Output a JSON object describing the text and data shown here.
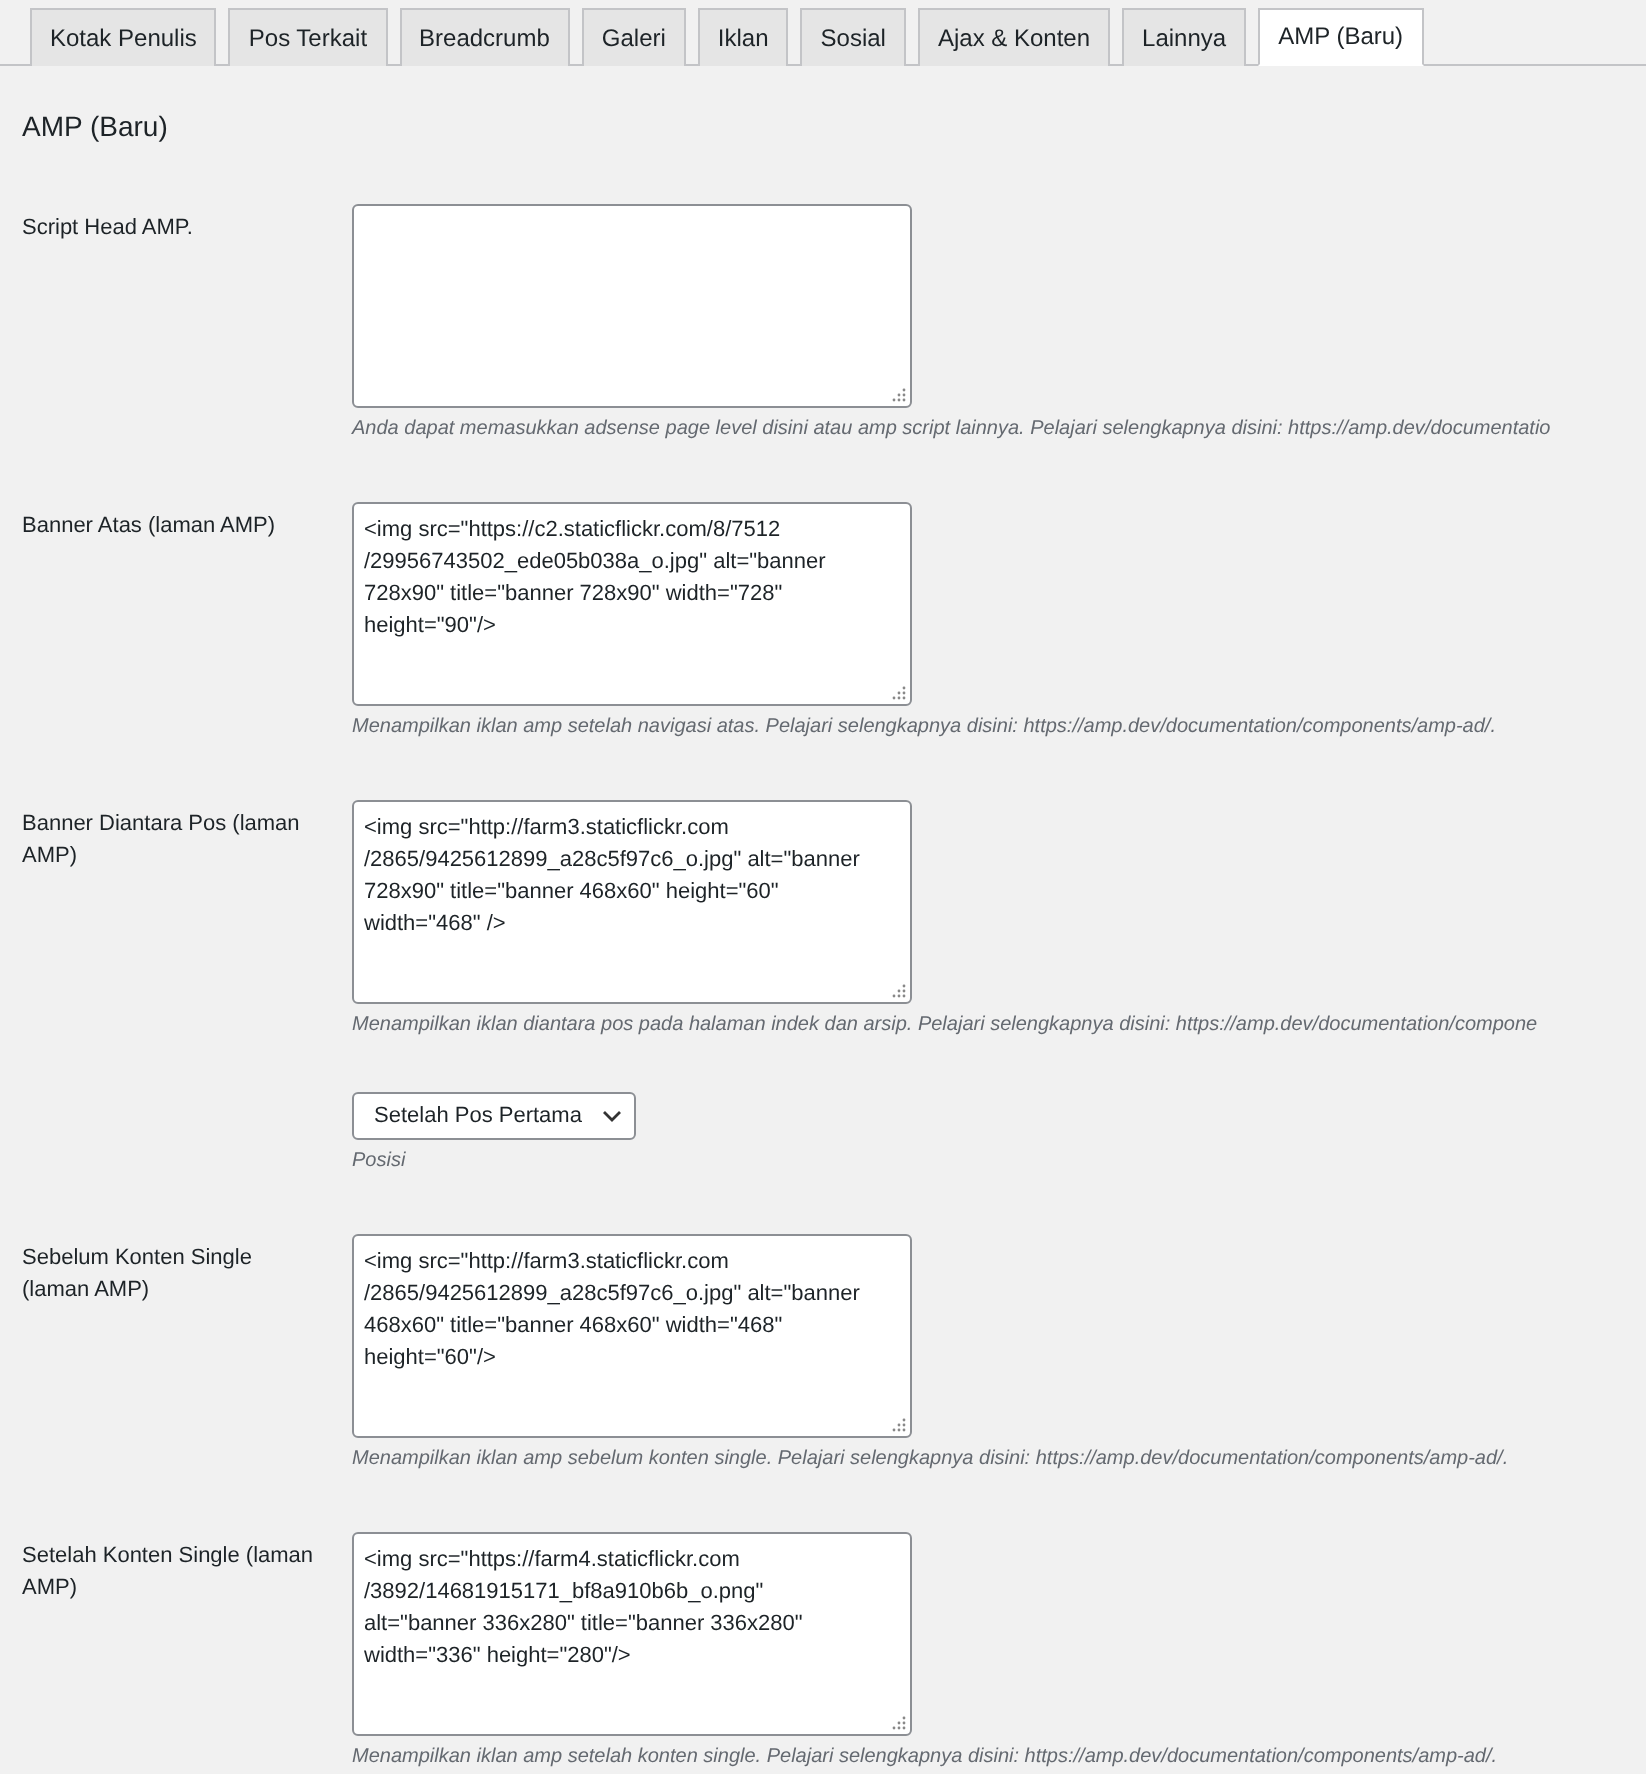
{
  "tabs": [
    {
      "label": "Kotak Penulis",
      "selected": false
    },
    {
      "label": "Pos Terkait",
      "selected": false
    },
    {
      "label": "Breadcrumb",
      "selected": false
    },
    {
      "label": "Galeri",
      "selected": false
    },
    {
      "label": "Iklan",
      "selected": false
    },
    {
      "label": "Sosial",
      "selected": false
    },
    {
      "label": "Ajax & Konten",
      "selected": false
    },
    {
      "label": "Lainnya",
      "selected": false
    },
    {
      "label": "AMP (Baru)",
      "selected": true
    }
  ],
  "section_title": "AMP (Baru)",
  "fields": [
    {
      "kind": "textarea",
      "label": "Script Head AMP.",
      "description": "Anda dapat memasukkan adsense page level disini atau amp script lainnya. Pelajari selengkapnya disini: https://amp.dev/documentatio"
    },
    {
      "kind": "textarea",
      "label": "Banner Atas (laman AMP)",
      "value": "<img src=\"https://c2.staticflickr.com/8/7512\n/29956743502_ede05b038a_o.jpg\" alt=\"banner\n728x90\" title=\"banner 728x90\" width=\"728\"\nheight=\"90\"/>",
      "description": "Menampilkan iklan amp setelah navigasi atas. Pelajari selengkapnya disini: https://amp.dev/documentation/components/amp-ad/."
    },
    {
      "kind": "textarea",
      "label": "Banner Diantara Pos (laman AMP)",
      "value": "<img src=\"http://farm3.staticflickr.com\n/2865/9425612899_a28c5f97c6_o.jpg\" alt=\"banner\n728x90\" title=\"banner 468x60\" height=\"60\"\nwidth=\"468\" />",
      "description": "Menampilkan iklan diantara pos pada halaman indek dan arsip. Pelajari selengkapnya disini: https://amp.dev/documentation/compone"
    },
    {
      "kind": "select",
      "value": "Setelah Pos Pertama",
      "description": "Posisi"
    },
    {
      "kind": "textarea",
      "label": "Sebelum Konten Single (laman AMP)",
      "value": "<img src=\"http://farm3.staticflickr.com\n/2865/9425612899_a28c5f97c6_o.jpg\" alt=\"banner\n468x60\" title=\"banner 468x60\" width=\"468\"\nheight=\"60\"/>",
      "description": "Menampilkan iklan amp sebelum konten single. Pelajari selengkapnya disini: https://amp.dev/documentation/components/amp-ad/."
    },
    {
      "kind": "textarea",
      "label": "Setelah Konten Single (laman AMP)",
      "value": "<img src=\"https://farm4.staticflickr.com\n/3892/14681915171_bf8a910b6b_o.png\"\nalt=\"banner 336x280\" title=\"banner 336x280\"\nwidth=\"336\" height=\"280\"/>",
      "description": "Menampilkan iklan amp setelah konten single. Pelajari selengkapnya disini: https://amp.dev/documentation/components/amp-ad/."
    }
  ]
}
